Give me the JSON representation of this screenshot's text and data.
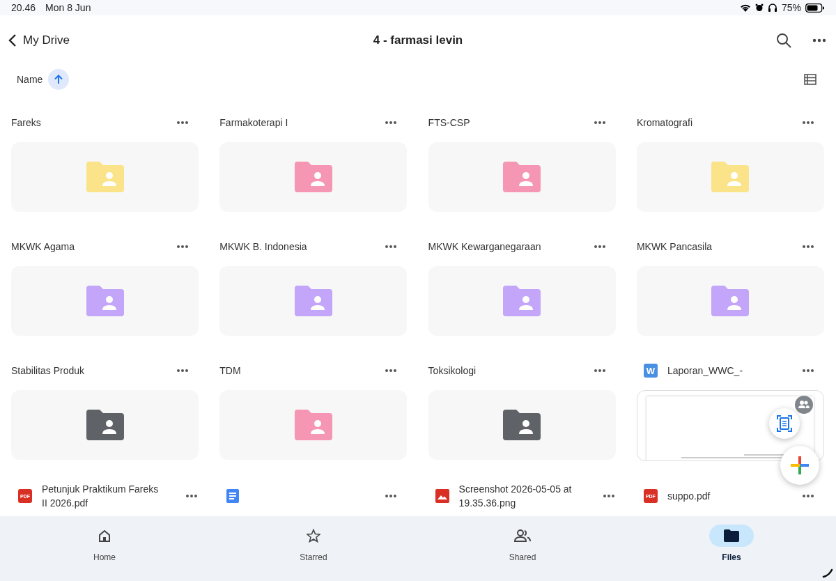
{
  "status_bar": {
    "time": "20.46",
    "date": "Mon 8 Jun",
    "battery": "75%"
  },
  "header": {
    "back_label": "My Drive",
    "title": "4 - farmasi levin"
  },
  "sort": {
    "label": "Name"
  },
  "items": [
    {
      "kind": "folder",
      "name": "Fareks",
      "color": "#fbe38a"
    },
    {
      "kind": "folder",
      "name": "Farmakoterapi I",
      "color": "#f597b4"
    },
    {
      "kind": "folder",
      "name": "FTS-CSP",
      "color": "#f597b4"
    },
    {
      "kind": "folder",
      "name": "Kromatografi",
      "color": "#fbe38a"
    },
    {
      "kind": "folder",
      "name": "MKWK Agama",
      "color": "#c3a5fa"
    },
    {
      "kind": "folder",
      "name": "MKWK B. Indonesia",
      "color": "#c3a5fa"
    },
    {
      "kind": "folder",
      "name": "MKWK Kewarganegaraan",
      "color": "#c3a5fa"
    },
    {
      "kind": "folder",
      "name": "MKWK Pancasila",
      "color": "#c3a5fa"
    },
    {
      "kind": "folder",
      "name": "Stabilitas Produk",
      "color": "#5f6368"
    },
    {
      "kind": "folder",
      "name": "TDM",
      "color": "#f597b4"
    },
    {
      "kind": "folder",
      "name": "Toksikologi",
      "color": "#5f6368"
    },
    {
      "kind": "word",
      "badge": "W",
      "name": "Laporan_WWC_-"
    },
    {
      "kind": "pdf",
      "badge": "PDF",
      "name": "Petunjuk Praktikum Fareks II 2026.pdf"
    },
    {
      "kind": "doc"
    },
    {
      "kind": "image",
      "name": "Screenshot 2026-05-05 at 19.35.36.png"
    },
    {
      "kind": "pdf",
      "badge": "PDF",
      "name": "suppo.pdf"
    }
  ],
  "nav": [
    {
      "label": "Home",
      "selected": false
    },
    {
      "label": "Starred",
      "selected": false
    },
    {
      "label": "Shared",
      "selected": false
    },
    {
      "label": "Files",
      "selected": true
    }
  ]
}
